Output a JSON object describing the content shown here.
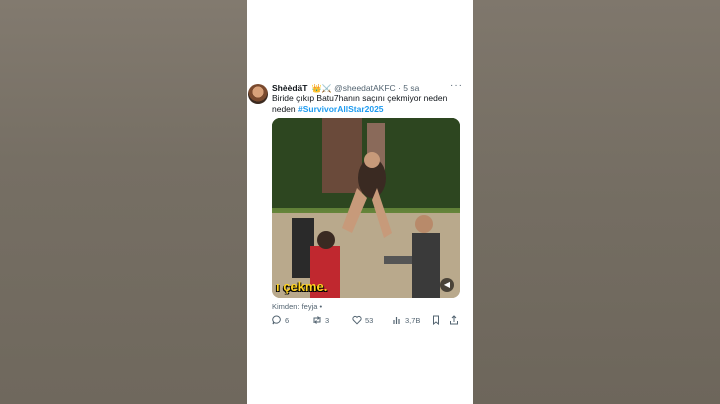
{
  "tweet": {
    "display_name": "ShèèdäT",
    "badges": "👑⚔️",
    "handle": "@sheedatAKFC",
    "separator": "·",
    "time": "5 sa",
    "more": "···",
    "text": "Biride çıkıp Batu7hanın saçını çekmiyor neden neden",
    "hashtag": "#SurvivorAllStar2025",
    "video_caption": "ı çekme.",
    "from_label": "Kimden: feyja •"
  },
  "actions": {
    "replies": "6",
    "retweets": "3",
    "likes": "53",
    "views": "3,7B"
  }
}
